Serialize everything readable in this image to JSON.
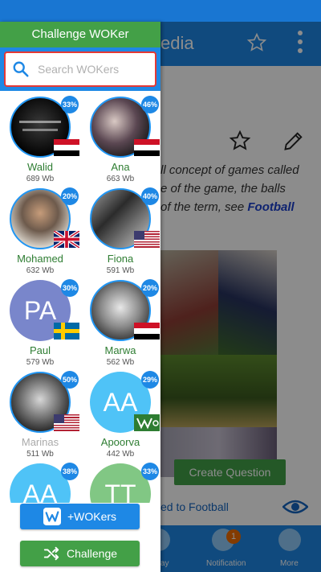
{
  "background": {
    "title_fragment": "edia",
    "text_lines": [
      "ll concept of games called",
      "e of the game, the balls",
      "of the term, see "
    ],
    "link_text": "Football",
    "create_question_label": "Create Question",
    "related_text": "ed to Football",
    "nav": {
      "play_label": "ay",
      "notification_label": "Notification",
      "notification_count": "1",
      "more_label": "More"
    }
  },
  "drawer": {
    "title": "Challenge WOKer",
    "search": {
      "placeholder": "Search WOKers",
      "value": ""
    },
    "users": [
      {
        "name": "Walid",
        "wb": "689 Wb",
        "percent": "33%",
        "flag": "egypt",
        "avatar": "photo-dark-arabic-text"
      },
      {
        "name": "Ana",
        "wb": "663 Wb",
        "percent": "46%",
        "flag": "egypt",
        "avatar": "photo-woman-arabic-text"
      },
      {
        "name": "Mohamed",
        "wb": "632 Wb",
        "percent": "20%",
        "flag": "uk",
        "avatar": "photo-man-fur-coat"
      },
      {
        "name": "Fiona",
        "wb": "591 Wb",
        "percent": "40%",
        "flag": "usa",
        "avatar": "photo-dali"
      },
      {
        "name": "Paul",
        "wb": "579 Wb",
        "percent": "30%",
        "flag": "sweden",
        "avatar": "initials",
        "initials": "PA",
        "avatar_color": "#7986cb"
      },
      {
        "name": "Marwa",
        "wb": "562 Wb",
        "percent": "20%",
        "flag": "egypt",
        "avatar": "photo-woman-portrait"
      },
      {
        "name": "Marinas",
        "wb": "511 Wb",
        "percent": "50%",
        "flag": "usa",
        "avatar": "photo-woman-face",
        "name_dimmed": true
      },
      {
        "name": "Apoorva",
        "wb": "442 Wb",
        "percent": "29%",
        "flag": "wok-logo",
        "avatar": "initials",
        "initials": "AA",
        "avatar_color": "#4fc3f7"
      },
      {
        "name": "",
        "wb": "",
        "percent": "38%",
        "flag": "",
        "avatar": "initials",
        "initials": "AA",
        "avatar_color": "#4fc3f7"
      },
      {
        "name": "",
        "wb": "",
        "percent": "33%",
        "flag": "",
        "avatar": "initials",
        "initials": "TT",
        "avatar_color": "#81c784"
      }
    ],
    "wokers_button_label": "+WOKers",
    "challenge_button_label": "Challenge"
  },
  "colors": {
    "primary_blue": "#1e88e5",
    "green": "#43a047",
    "search_border": "#e53935"
  }
}
